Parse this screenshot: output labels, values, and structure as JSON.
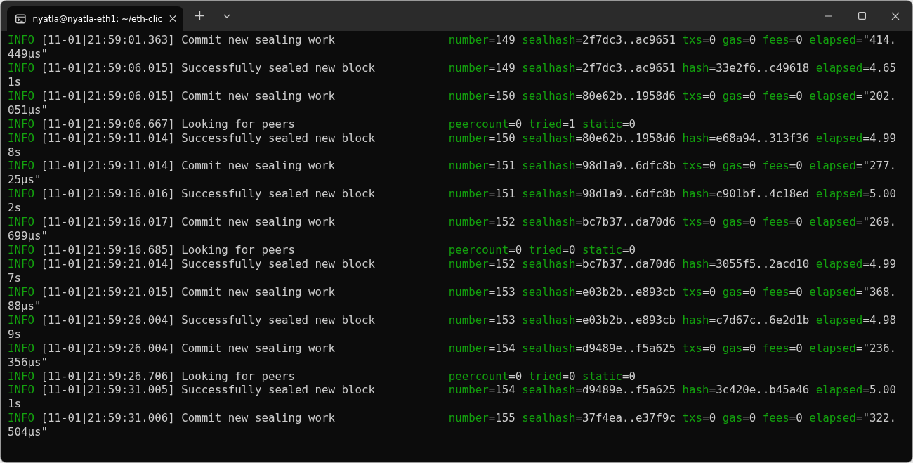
{
  "window": {
    "tab_title": "nyatla@nyatla-eth1: ~/eth-clic"
  },
  "lines": [
    {
      "level": "INFO",
      "timestamp": "[11-01|21:59:01.363]",
      "message": "Commit new sealing work",
      "fields": [
        {
          "key": "number",
          "separator": "=",
          "value": "149"
        },
        {
          "key": "sealhash",
          "separator": "=",
          "value": "2f7dc3..ac9651"
        },
        {
          "key": "txs",
          "separator": "=",
          "value": "0"
        },
        {
          "key": "gas",
          "separator": "=",
          "value": "0"
        },
        {
          "key": "fees",
          "separator": "=",
          "value": "0"
        },
        {
          "key": "elapsed",
          "separator": "=",
          "value": "\"414."
        }
      ],
      "continuation": "449µs\""
    },
    {
      "level": "INFO",
      "timestamp": "[11-01|21:59:06.015]",
      "message": "Successfully sealed new block",
      "fields": [
        {
          "key": "number",
          "separator": "=",
          "value": "149"
        },
        {
          "key": "sealhash",
          "separator": "=",
          "value": "2f7dc3..ac9651"
        },
        {
          "key": "hash",
          "separator": "=",
          "value": "33e2f6..c49618"
        },
        {
          "key": "elapsed",
          "separator": "=",
          "value": "4.65"
        }
      ],
      "continuation": "1s"
    },
    {
      "level": "INFO",
      "timestamp": "[11-01|21:59:06.015]",
      "message": "Commit new sealing work",
      "fields": [
        {
          "key": "number",
          "separator": "=",
          "value": "150"
        },
        {
          "key": "sealhash",
          "separator": "=",
          "value": "80e62b..1958d6"
        },
        {
          "key": "txs",
          "separator": "=",
          "value": "0"
        },
        {
          "key": "gas",
          "separator": "=",
          "value": "0"
        },
        {
          "key": "fees",
          "separator": "=",
          "value": "0"
        },
        {
          "key": "elapsed",
          "separator": "=",
          "value": "\"202."
        }
      ],
      "continuation": "051µs\""
    },
    {
      "level": "INFO",
      "timestamp": "[11-01|21:59:06.667]",
      "message": "Looking for peers",
      "fields": [
        {
          "key": "peercount",
          "separator": "=",
          "value": "0"
        },
        {
          "key": "tried",
          "separator": "=",
          "value": "1"
        },
        {
          "key": "static",
          "separator": "=",
          "value": "0"
        }
      ]
    },
    {
      "level": "INFO",
      "timestamp": "[11-01|21:59:11.014]",
      "message": "Successfully sealed new block",
      "fields": [
        {
          "key": "number",
          "separator": "=",
          "value": "150"
        },
        {
          "key": "sealhash",
          "separator": "=",
          "value": "80e62b..1958d6"
        },
        {
          "key": "hash",
          "separator": "=",
          "value": "e68a94..313f36"
        },
        {
          "key": "elapsed",
          "separator": "=",
          "value": "4.99"
        }
      ],
      "continuation": "8s"
    },
    {
      "level": "INFO",
      "timestamp": "[11-01|21:59:11.014]",
      "message": "Commit new sealing work",
      "fields": [
        {
          "key": "number",
          "separator": "=",
          "value": "151"
        },
        {
          "key": "sealhash",
          "separator": "=",
          "value": "98d1a9..6dfc8b"
        },
        {
          "key": "txs",
          "separator": "=",
          "value": "0"
        },
        {
          "key": "gas",
          "separator": "=",
          "value": "0"
        },
        {
          "key": "fees",
          "separator": "=",
          "value": "0"
        },
        {
          "key": "elapsed",
          "separator": "=",
          "value": "\"277."
        }
      ],
      "continuation": "25µs\""
    },
    {
      "level": "INFO",
      "timestamp": "[11-01|21:59:16.016]",
      "message": "Successfully sealed new block",
      "fields": [
        {
          "key": "number",
          "separator": "=",
          "value": "151"
        },
        {
          "key": "sealhash",
          "separator": "=",
          "value": "98d1a9..6dfc8b"
        },
        {
          "key": "hash",
          "separator": "=",
          "value": "c901bf..4c18ed"
        },
        {
          "key": "elapsed",
          "separator": "=",
          "value": "5.00"
        }
      ],
      "continuation": "2s"
    },
    {
      "level": "INFO",
      "timestamp": "[11-01|21:59:16.017]",
      "message": "Commit new sealing work",
      "fields": [
        {
          "key": "number",
          "separator": "=",
          "value": "152"
        },
        {
          "key": "sealhash",
          "separator": "=",
          "value": "bc7b37..da70d6"
        },
        {
          "key": "txs",
          "separator": "=",
          "value": "0"
        },
        {
          "key": "gas",
          "separator": "=",
          "value": "0"
        },
        {
          "key": "fees",
          "separator": "=",
          "value": "0"
        },
        {
          "key": "elapsed",
          "separator": "=",
          "value": "\"269."
        }
      ],
      "continuation": "699µs\""
    },
    {
      "level": "INFO",
      "timestamp": "[11-01|21:59:16.685]",
      "message": "Looking for peers",
      "fields": [
        {
          "key": "peercount",
          "separator": "=",
          "value": "0"
        },
        {
          "key": "tried",
          "separator": "=",
          "value": "0"
        },
        {
          "key": "static",
          "separator": "=",
          "value": "0"
        }
      ]
    },
    {
      "level": "INFO",
      "timestamp": "[11-01|21:59:21.014]",
      "message": "Successfully sealed new block",
      "fields": [
        {
          "key": "number",
          "separator": "=",
          "value": "152"
        },
        {
          "key": "sealhash",
          "separator": "=",
          "value": "bc7b37..da70d6"
        },
        {
          "key": "hash",
          "separator": "=",
          "value": "3055f5..2acd10"
        },
        {
          "key": "elapsed",
          "separator": "=",
          "value": "4.99"
        }
      ],
      "continuation": "7s"
    },
    {
      "level": "INFO",
      "timestamp": "[11-01|21:59:21.015]",
      "message": "Commit new sealing work",
      "fields": [
        {
          "key": "number",
          "separator": "=",
          "value": "153"
        },
        {
          "key": "sealhash",
          "separator": "=",
          "value": "e03b2b..e893cb"
        },
        {
          "key": "txs",
          "separator": "=",
          "value": "0"
        },
        {
          "key": "gas",
          "separator": "=",
          "value": "0"
        },
        {
          "key": "fees",
          "separator": "=",
          "value": "0"
        },
        {
          "key": "elapsed",
          "separator": "=",
          "value": "\"368."
        }
      ],
      "continuation": "88µs\""
    },
    {
      "level": "INFO",
      "timestamp": "[11-01|21:59:26.004]",
      "message": "Successfully sealed new block",
      "fields": [
        {
          "key": "number",
          "separator": "=",
          "value": "153"
        },
        {
          "key": "sealhash",
          "separator": "=",
          "value": "e03b2b..e893cb"
        },
        {
          "key": "hash",
          "separator": "=",
          "value": "c7d67c..6e2d1b"
        },
        {
          "key": "elapsed",
          "separator": "=",
          "value": "4.98"
        }
      ],
      "continuation": "9s"
    },
    {
      "level": "INFO",
      "timestamp": "[11-01|21:59:26.004]",
      "message": "Commit new sealing work",
      "fields": [
        {
          "key": "number",
          "separator": "=",
          "value": "154"
        },
        {
          "key": "sealhash",
          "separator": "=",
          "value": "d9489e..f5a625"
        },
        {
          "key": "txs",
          "separator": "=",
          "value": "0"
        },
        {
          "key": "gas",
          "separator": "=",
          "value": "0"
        },
        {
          "key": "fees",
          "separator": "=",
          "value": "0"
        },
        {
          "key": "elapsed",
          "separator": "=",
          "value": "\"236."
        }
      ],
      "continuation": "356µs\""
    },
    {
      "level": "INFO",
      "timestamp": "[11-01|21:59:26.706]",
      "message": "Looking for peers",
      "fields": [
        {
          "key": "peercount",
          "separator": "=",
          "value": "0"
        },
        {
          "key": "tried",
          "separator": "=",
          "value": "0"
        },
        {
          "key": "static",
          "separator": "=",
          "value": "0"
        }
      ]
    },
    {
      "level": "INFO",
      "timestamp": "[11-01|21:59:31.005]",
      "message": "Successfully sealed new block",
      "fields": [
        {
          "key": "number",
          "separator": "=",
          "value": "154"
        },
        {
          "key": "sealhash",
          "separator": "=",
          "value": "d9489e..f5a625"
        },
        {
          "key": "hash",
          "separator": "=",
          "value": "3c420e..b45a46"
        },
        {
          "key": "elapsed",
          "separator": "=",
          "value": "5.00"
        }
      ],
      "continuation": "1s"
    },
    {
      "level": "INFO",
      "timestamp": "[11-01|21:59:31.006]",
      "message": "Commit new sealing work",
      "fields": [
        {
          "key": "number",
          "separator": "=",
          "value": "155"
        },
        {
          "key": "sealhash",
          "separator": "=",
          "value": "37f4ea..e37f9c"
        },
        {
          "key": "txs",
          "separator": "=",
          "value": "0"
        },
        {
          "key": "gas",
          "separator": "=",
          "value": "0"
        },
        {
          "key": "fees",
          "separator": "=",
          "value": "0"
        },
        {
          "key": "elapsed",
          "separator": "=",
          "value": "\"322."
        }
      ],
      "continuation": "504µs\""
    }
  ]
}
